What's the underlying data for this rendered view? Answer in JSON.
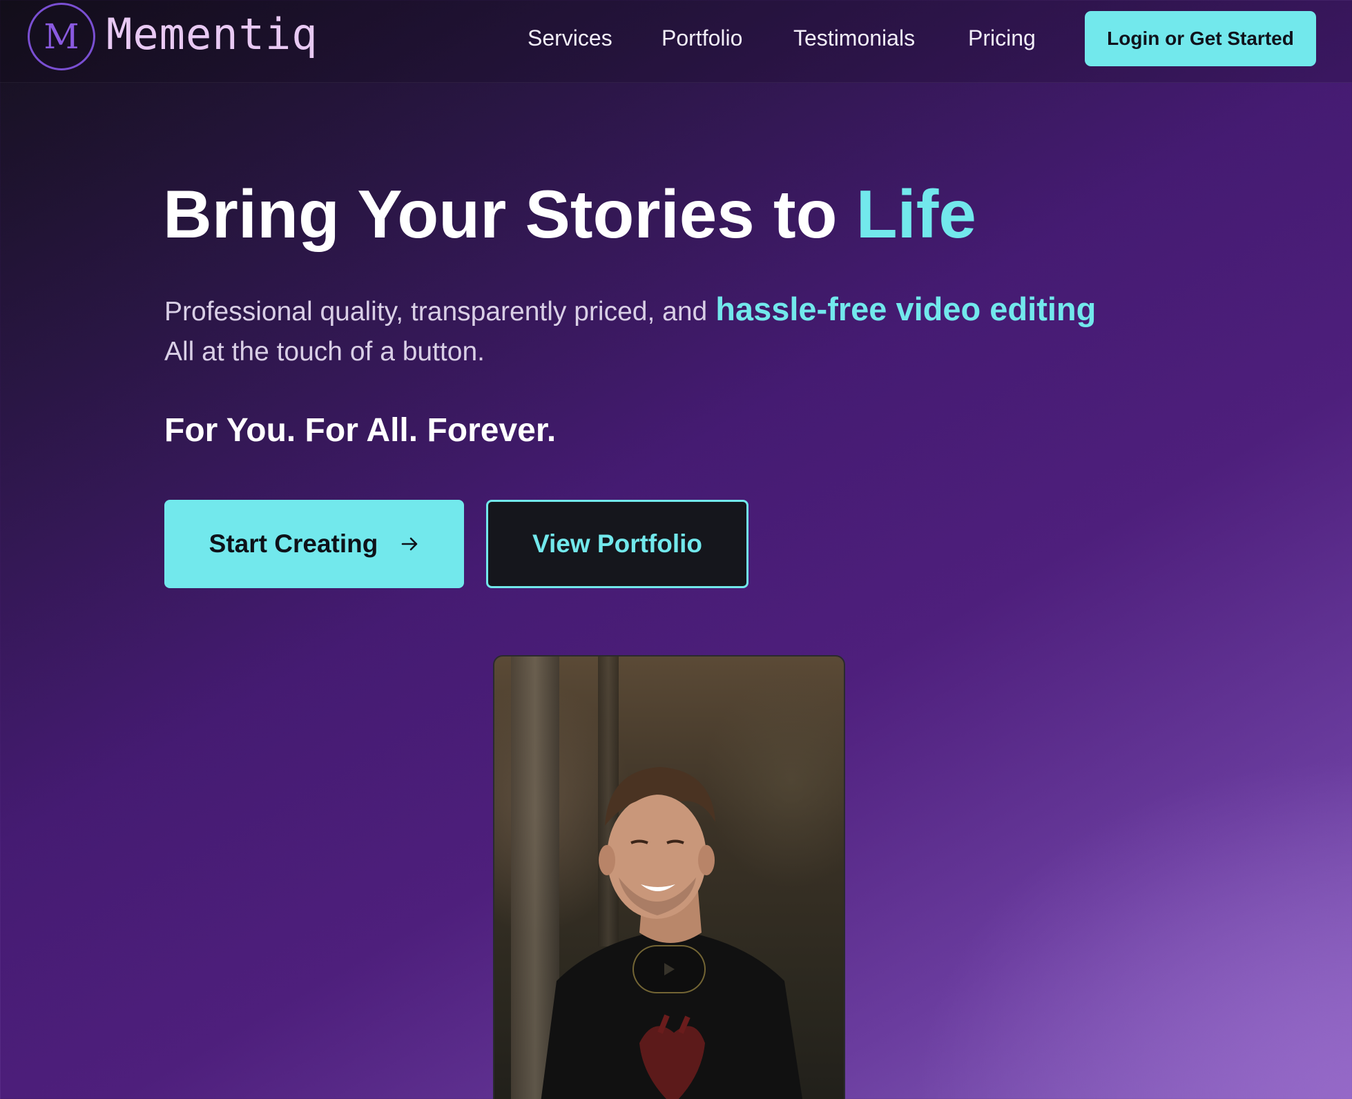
{
  "brand": {
    "logo_letter": "M",
    "name": "Mementiq"
  },
  "nav": {
    "items": [
      {
        "label": "Services"
      },
      {
        "label": "Portfolio"
      },
      {
        "label": "Testimonials"
      },
      {
        "label": "Pricing"
      }
    ],
    "cta_label": "Login or Get Started"
  },
  "hero": {
    "title_main": "Bring Your Stories to ",
    "title_accent": "Life",
    "subtitle_plain": "Professional quality, transparently priced, and",
    "subtitle_accent": "hassle-free video editing",
    "subtitle_line2": "All at the touch of a button.",
    "tagline": "For You. For All. Forever.",
    "primary_button": "Start Creating",
    "secondary_button": "View Portfolio"
  },
  "video": {
    "play_icon": "play-icon"
  },
  "colors": {
    "accent": "#72e8ec",
    "background_dark": "#14101c",
    "background_purple": "#4e1f7c",
    "logo_purple": "#7a4fd2",
    "logo_text": "#e8c9f3"
  }
}
